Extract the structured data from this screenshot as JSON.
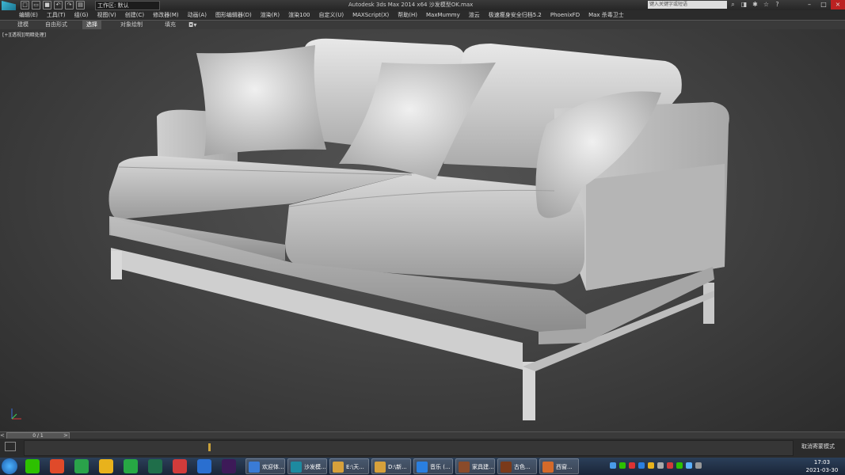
{
  "app": {
    "title": "Autodesk 3ds Max  2014 x64     沙发模型OK.max",
    "workspace": "工作区: 默认",
    "search_placeholder": "键入关键字或短语"
  },
  "menu": [
    "编辑(E)",
    "工具(T)",
    "组(G)",
    "视图(V)",
    "创建(C)",
    "修改器(M)",
    "动画(A)",
    "图形编辑器(D)",
    "渲染(R)",
    "渲染100",
    "自定义(U)",
    "MAXScript(X)",
    "帮助(H)",
    "MaxMummy",
    "渲云",
    "极速瘦身安全归档5.2",
    "PhoenixFD",
    "Max 杀毒卫士"
  ],
  "ribbon": {
    "tabs": [
      "建模",
      "自由形式",
      "选择",
      "对象绘制",
      "填充"
    ],
    "active": "选择"
  },
  "viewport": {
    "label": "[+][透视][明暗处理]"
  },
  "timeline": {
    "frame": "0 / 1"
  },
  "status": {
    "text": "取消寄蒙模式"
  },
  "taskbar": {
    "tasks": [
      {
        "label": "欢迎体...",
        "color": "#3a7bd5"
      },
      {
        "label": "沙发模...",
        "color": "#1e8aa0"
      },
      {
        "label": "E:\\天...",
        "color": "#d7a13b"
      },
      {
        "label": "D:\\新...",
        "color": "#d7a13b"
      },
      {
        "label": "音乐 (...",
        "color": "#2a7fe0"
      },
      {
        "label": "家具建...",
        "color": "#8a4b2a"
      },
      {
        "label": "古色...",
        "color": "#7a3a1a"
      },
      {
        "label": "西窗...",
        "color": "#d36a2a"
      }
    ],
    "pinned": [
      {
        "name": "wechat-icon",
        "color": "#2dc100"
      },
      {
        "name": "camtasia-icon",
        "color": "#e04a2a"
      },
      {
        "name": "camtasia-green-icon",
        "color": "#2aa34a"
      },
      {
        "name": "chrome-icon",
        "color": "#e8b21c"
      },
      {
        "name": "xbox-icon",
        "color": "#27a844"
      },
      {
        "name": "audition-icon",
        "color": "#1f6e4a"
      },
      {
        "name": "wanjia-icon",
        "color": "#d13b3b"
      },
      {
        "name": "photos-icon",
        "color": "#2a6fd0"
      },
      {
        "name": "premiere-icon",
        "color": "#3d1a58"
      }
    ],
    "time": "17:03",
    "date": "2021-03-30"
  }
}
